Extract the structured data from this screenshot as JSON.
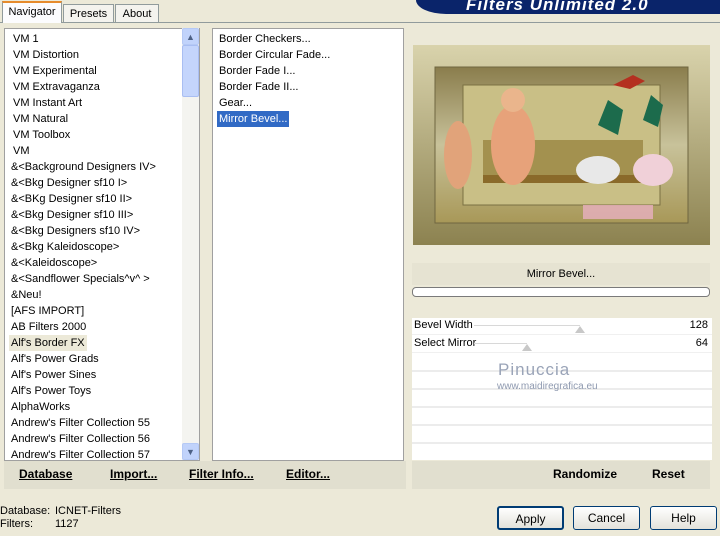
{
  "window": {
    "title": "Filters Unlimited 2.0",
    "tabs": [
      "Navigator",
      "Presets",
      "About"
    ]
  },
  "categories": [
    "VM 1",
    "VM Distortion",
    "VM Experimental",
    "VM Extravaganza",
    "VM Instant Art",
    "VM Natural",
    "VM Toolbox",
    "VM",
    "&<Background Designers IV>",
    "&<Bkg Designer sf10 I>",
    "&<BKg Designer sf10 II>",
    "&<Bkg Designer sf10 III>",
    "&<Bkg Designers sf10 IV>",
    "&<Bkg Kaleidoscope>",
    "&<Kaleidoscope>",
    "&<Sandflower Specials^v^ >",
    "&Neu!",
    "[AFS IMPORT]",
    "AB Filters 2000",
    "Alf's Border FX",
    "Alf's Power Grads",
    "Alf's Power Sines",
    "Alf's Power Toys",
    "AlphaWorks",
    "Andrew's Filter Collection 55",
    "Andrew's Filter Collection 56",
    "Andrew's Filter Collection 57"
  ],
  "selected_category": "Alf's Border FX",
  "filters": [
    "Border Checkers...",
    "Border Circular Fade...",
    "Border Fade I...",
    "Border Fade II...",
    "Gear...",
    "Mirror Bevel..."
  ],
  "selected_filter": "Mirror Bevel...",
  "current_filter_label": "Mirror Bevel...",
  "params": [
    {
      "label": "Bevel Width",
      "value": "128",
      "level": 0.502
    },
    {
      "label": "Select Mirror",
      "value": "64",
      "level": 0.251
    }
  ],
  "watermark": {
    "name": "Pinuccia",
    "site": "www.maidiregrafica.eu"
  },
  "buttons": {
    "database": "Database",
    "import": "Import...",
    "filter_info": "Filter Info...",
    "editor": "Editor...",
    "randomize": "Randomize",
    "reset": "Reset",
    "apply": "Apply",
    "cancel": "Cancel",
    "help": "Help"
  },
  "status": {
    "database_label": "Database:",
    "database_value": "ICNET-Filters",
    "filters_label": "Filters:",
    "filters_value": "1127"
  }
}
